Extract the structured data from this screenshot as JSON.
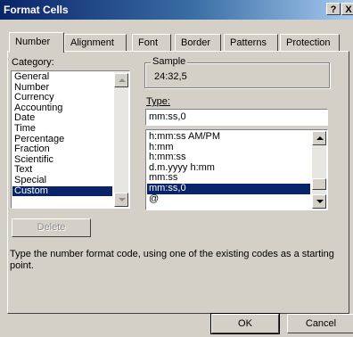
{
  "window": {
    "title": "Format Cells",
    "help_btn": "?",
    "close_btn": "X"
  },
  "tabs": [
    "Number",
    "Alignment",
    "Font",
    "Border",
    "Patterns",
    "Protection"
  ],
  "category": {
    "label": "Category:",
    "items": [
      "General",
      "Number",
      "Currency",
      "Accounting",
      "Date",
      "Time",
      "Percentage",
      "Fraction",
      "Scientific",
      "Text",
      "Special",
      "Custom"
    ],
    "selected": "Custom"
  },
  "sample": {
    "legend": "Sample",
    "value": "24:32,5"
  },
  "type": {
    "label": "Type:",
    "value": "mm:ss,0",
    "items": [
      "h:mm:ss AM/PM",
      "h:mm",
      "h:mm:ss",
      "d.m.yyyy h:mm",
      "mm:ss",
      "mm:ss,0",
      "@"
    ],
    "selected": "mm:ss,0"
  },
  "buttons": {
    "delete": "Delete",
    "ok": "OK",
    "cancel": "Cancel"
  },
  "description": "Type the number format code, using one of the existing codes as a starting point.",
  "colors": {
    "title_bar": "#0a246a",
    "dialog_face": "#d4d0c8",
    "selection": "#0a246a"
  }
}
